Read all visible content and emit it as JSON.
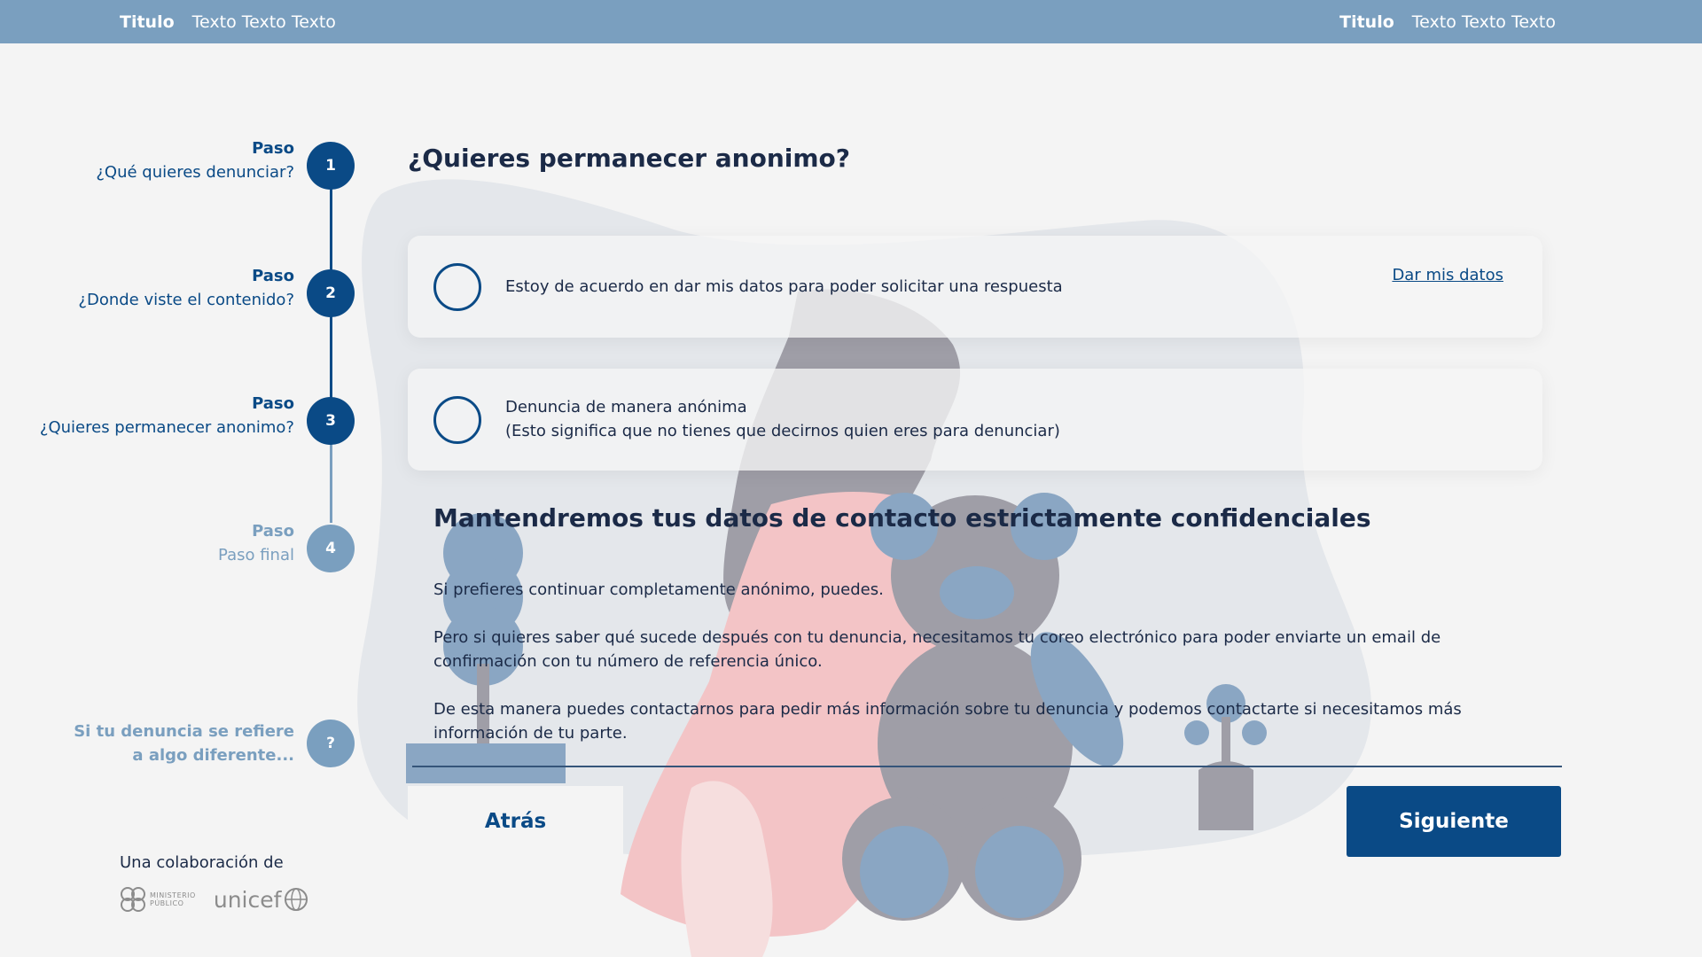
{
  "topbar": {
    "left": {
      "title": "Titulo",
      "text": "Texto Texto Texto"
    },
    "right": {
      "title": "Titulo",
      "text": "Texto Texto Texto"
    }
  },
  "stepper": {
    "steps": [
      {
        "paso": "Paso",
        "label": "¿Qué quieres denunciar?",
        "number": "1",
        "state": "done"
      },
      {
        "paso": "Paso",
        "label": "¿Donde viste el contenido?",
        "number": "2",
        "state": "done"
      },
      {
        "paso": "Paso",
        "label": "¿Quieres permanecer anonimo?",
        "number": "3",
        "state": "current"
      },
      {
        "paso": "Paso",
        "label": "Paso final",
        "number": "4",
        "state": "pending"
      }
    ],
    "help": {
      "line1": "Si tu denuncia se refiere",
      "line2": "a algo diferente...",
      "icon": "?"
    }
  },
  "collaboration": {
    "label": "Una colaboración de",
    "logo1": {
      "line1": "MINISTERIO",
      "line2": "PÚBLICO"
    },
    "logo2": "unicef"
  },
  "main": {
    "title": "¿Quieres permanecer anonimo?",
    "options": [
      {
        "text": "Estoy de acuerdo en dar mis datos para poder solicitar una respuesta",
        "link": "Dar mis datos"
      },
      {
        "text": "Denuncia de manera anónima",
        "subtext": "(Esto significa que no tienes que decirnos quien eres para denunciar)"
      }
    ],
    "section_title": "Mantendremos tus datos de contacto estrictamente confidenciales",
    "paragraphs": [
      "Si prefieres continuar completamente anónimo, puedes.",
      "Pero si quieres saber qué sucede después con tu denuncia, necesitamos tu coreo electrónico para poder enviarte un email de confirmación con tu número de referencia único.",
      "De esta manera puedes contactarnos para pedir más información sobre tu denuncia y podemos contactarte si necesitamos más información de tu parte."
    ],
    "back_label": "Atrás",
    "next_label": "Siguiente"
  },
  "colors": {
    "topbar": "#7a9fbf",
    "primary": "#0a4a86",
    "pending": "#7a9fbf",
    "background": "#f4f4f4",
    "text": "#1b2a47"
  }
}
